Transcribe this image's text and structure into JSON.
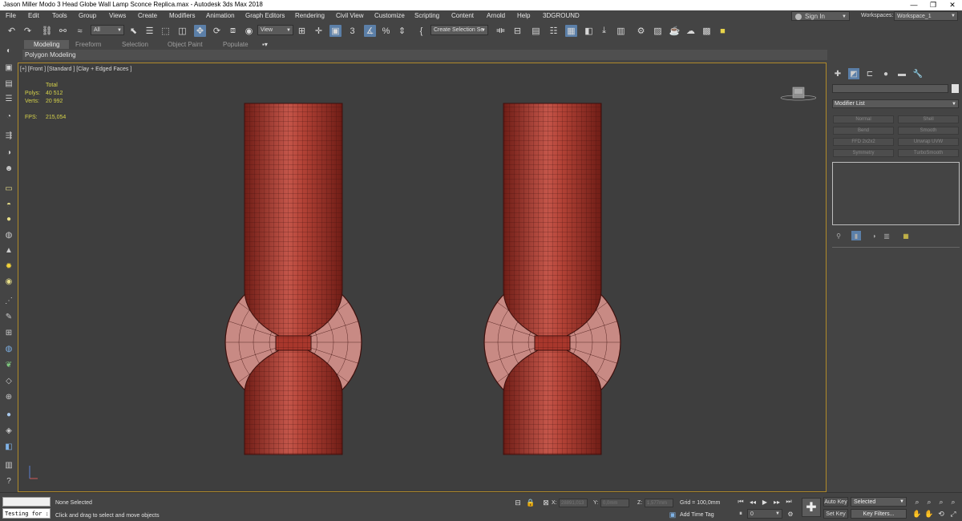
{
  "app": {
    "title": "Jason Miller Modo 3 Head Globe Wall Lamp Sconce Replica.max - Autodesk 3ds Max 2018",
    "window_buttons": [
      "—",
      "❐",
      "✕"
    ]
  },
  "menu": {
    "items": [
      "File",
      "Edit",
      "Tools",
      "Group",
      "Views",
      "Create",
      "Modifiers",
      "Animation",
      "Graph Editors",
      "Rendering",
      "Civil View",
      "Customize",
      "Scripting",
      "Content",
      "Arnold",
      "Help",
      "3DGROUND"
    ],
    "sign_in": "Sign In",
    "workspaces_label": "Workspaces:",
    "workspace_value": "Workspace_1"
  },
  "toolbar": {
    "filter_value": "All",
    "refcoord_value": "View",
    "selection_set_placeholder": "Create Selection Se",
    "snap_label": "3",
    "percent_label": "%"
  },
  "ribbon": {
    "tabs": [
      "Modeling",
      "Freeform",
      "Selection",
      "Object Paint",
      "Populate"
    ],
    "active_tab": "Modeling",
    "subpanel": "Polygon Modeling"
  },
  "viewport": {
    "label": "[+] [Front ] [Standard ] [Clay + Edged Faces ]",
    "stats": {
      "total_label": "Total",
      "polys_label": "Polys:",
      "polys_value": "40 512",
      "verts_label": "Verts:",
      "verts_value": "20 992",
      "fps_label": "FPS:",
      "fps_value": "215,054"
    },
    "colors": {
      "lamp_body": "#a8372c",
      "lamp_wire": "#3d0f0c",
      "lamp_disc": "#c88a84",
      "frame": "#b08a2a"
    }
  },
  "command_panel": {
    "modifier_list_label": "Modifier List",
    "modifier_buttons": [
      "Normal",
      "Shell",
      "Bend",
      "Smooth",
      "FFD 2x2x2",
      "Unwrap UVW",
      "Symmetry",
      "TurboSmooth"
    ]
  },
  "status": {
    "maxscript_input": "Testing for :",
    "selection_status": "None Selected",
    "prompt": "Click and drag to select and move objects",
    "x_label": "X:",
    "x_value": "28891,013",
    "y_label": "Y:",
    "y_value": "0,0mm",
    "z_label": "Z:",
    "z_value": "1,577mm",
    "grid": "Grid = 100,0mm",
    "add_time_tag": "Add Time Tag",
    "frame_value": "0",
    "auto_key": "Auto Key",
    "set_key": "Set Key",
    "key_mode": "Selected",
    "key_filters": "Key Filters..."
  }
}
